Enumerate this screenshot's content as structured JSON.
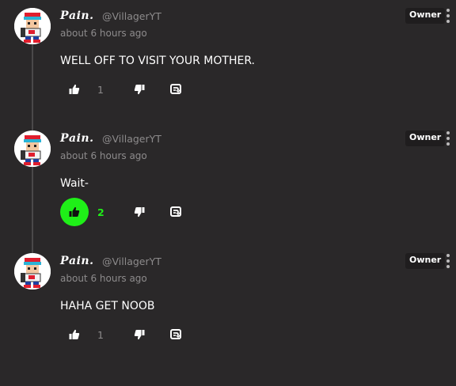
{
  "comments": [
    {
      "author": "𝑷𝒂𝒊𝒏.",
      "handle": "@VillagerYT",
      "time": "about 6 hours ago",
      "badge": "Owner",
      "text": "WELL OFF TO VISIT YOUR MOTHER.",
      "likes": "1",
      "liked": false
    },
    {
      "author": "𝑷𝒂𝒊𝒏.",
      "handle": "@VillagerYT",
      "time": "about 6 hours ago",
      "badge": "Owner",
      "text": "Wait-",
      "likes": "2",
      "liked": true
    },
    {
      "author": "𝑷𝒂𝒊𝒏.",
      "handle": "@VillagerYT",
      "time": "about 6 hours ago",
      "badge": "Owner",
      "text": "HAHA GET NOOB",
      "likes": "1",
      "liked": false
    }
  ],
  "icons": {
    "like": "thumbs-up-icon",
    "dislike": "thumbs-down-icon",
    "reply": "reply-icon",
    "more": "more-vertical-icon"
  },
  "colors": {
    "background": "#2a2829",
    "liked": "#1fef18",
    "muted": "#8d8b8c"
  }
}
